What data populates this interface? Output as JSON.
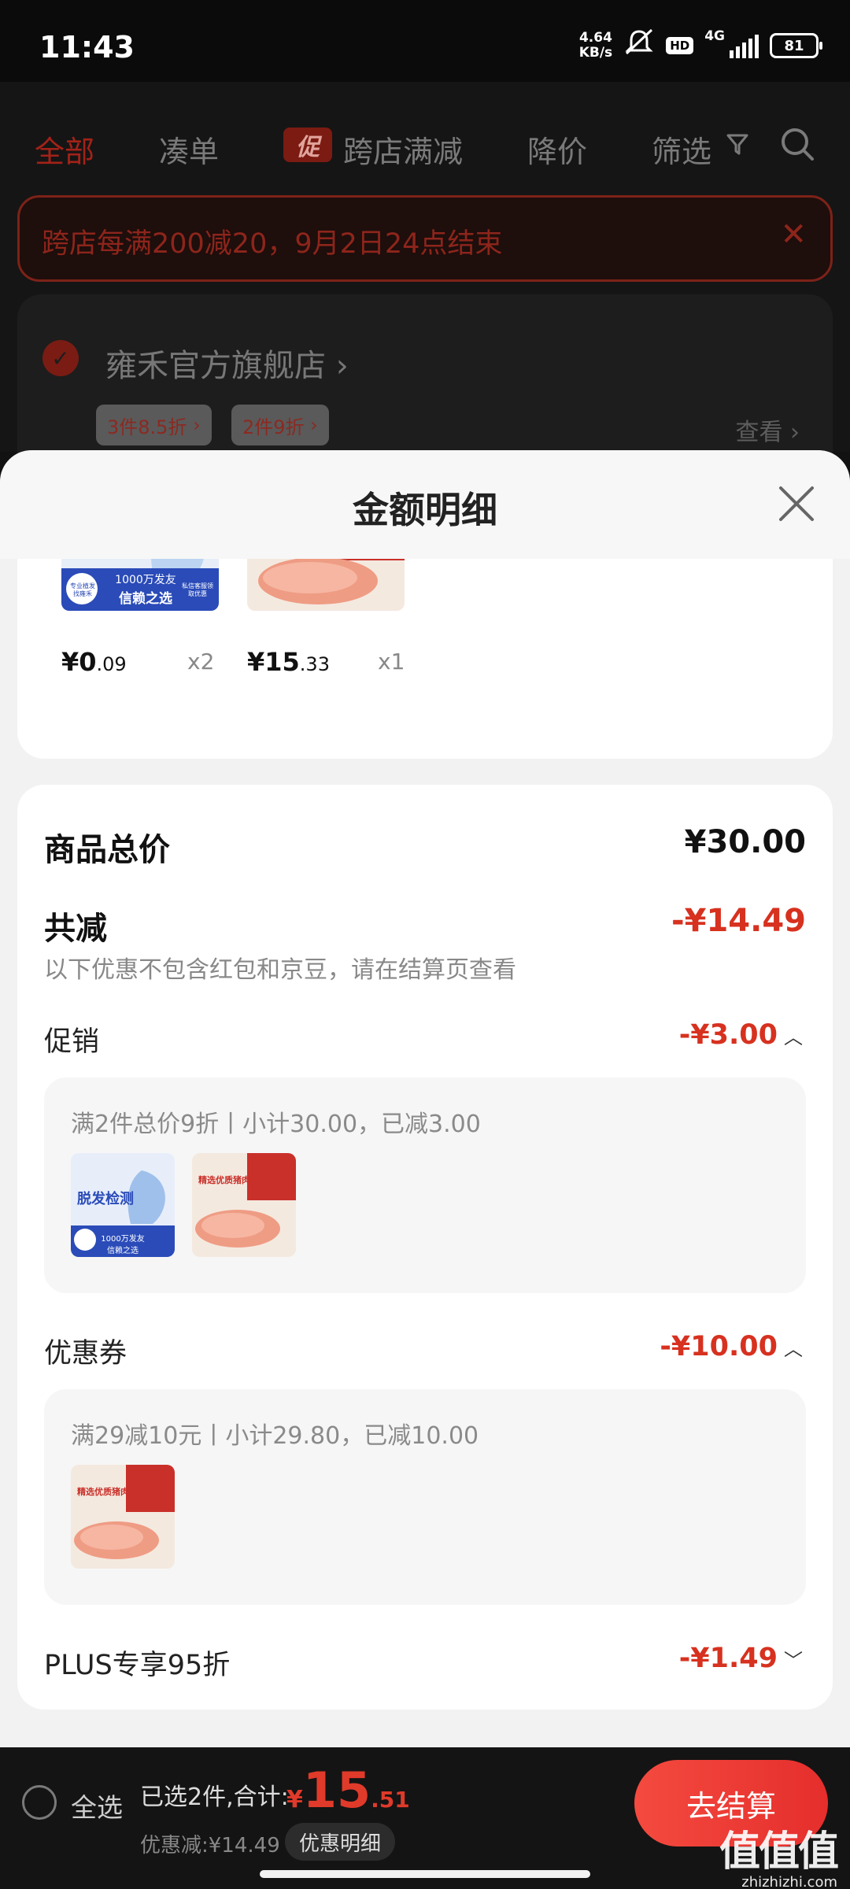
{
  "status_bar": {
    "time": "11:43",
    "net_speed_value": "4.64",
    "net_speed_unit": "KB/s",
    "hd": "HD",
    "network": "4G",
    "battery": "81"
  },
  "filter_tabs": {
    "all": "全部",
    "combine": "凑单",
    "promo_icon": "促",
    "cross_store": "跨店满减",
    "price_drop": "降价",
    "filter": "筛选"
  },
  "banner": {
    "text": "跨店每满200减20，9月2日24点结束"
  },
  "store": {
    "name": "雍禾官方旗舰店",
    "chips": [
      "3件8.5折",
      "2件9折"
    ],
    "view": "查看"
  },
  "sheet": {
    "title": "金额明细",
    "items": [
      {
        "price_int": "¥0",
        "price_dec": ".09",
        "qty": "x2",
        "thumb_line1": "1000万发友",
        "thumb_line2": "信赖之选",
        "thumb_tag1": "专业植发找雍禾",
        "thumb_tag2": "私信客服领取优惠"
      },
      {
        "price_int": "¥15",
        "price_dec": ".33",
        "qty": "x1",
        "thumb_label": "精选优质猪肉"
      }
    ],
    "total_label": "商品总价",
    "total_value": "¥30.00",
    "reduce_label": "共减",
    "reduce_value": "-¥14.49",
    "note": "以下优惠不包含红包和京豆，请在结算页查看",
    "promo": {
      "label": "促销",
      "value": "-¥3.00",
      "detail": "满2件总价9折丨小计30.00，已减3.00",
      "thumb1_title": "脱发检测",
      "thumb1_badge": "1000万发友信赖之选",
      "thumb2_title": "精选优质猪肉"
    },
    "coupon": {
      "label": "优惠券",
      "value": "-¥10.00",
      "detail": "满29减10元丨小计29.80，已减10.00",
      "thumb_title": "精选优质猪肉"
    },
    "plus": {
      "label": "PLUS专享95折",
      "value": "-¥1.49"
    }
  },
  "bottom_bar": {
    "select_all": "全选",
    "selected_text": "已选2件,合计:",
    "total_currency": "¥",
    "total_int": "15",
    "total_dec": ".51",
    "discount_text": "优惠减:¥14.49",
    "detail_pill": "优惠明细",
    "checkout": "去结算",
    "watermark_big": "值值值",
    "watermark_small": "zhizhizhi.com"
  },
  "colors": {
    "accent_red": "#d7311f",
    "checkout_red": "#e52e2c",
    "dim_red": "#8d251b"
  }
}
